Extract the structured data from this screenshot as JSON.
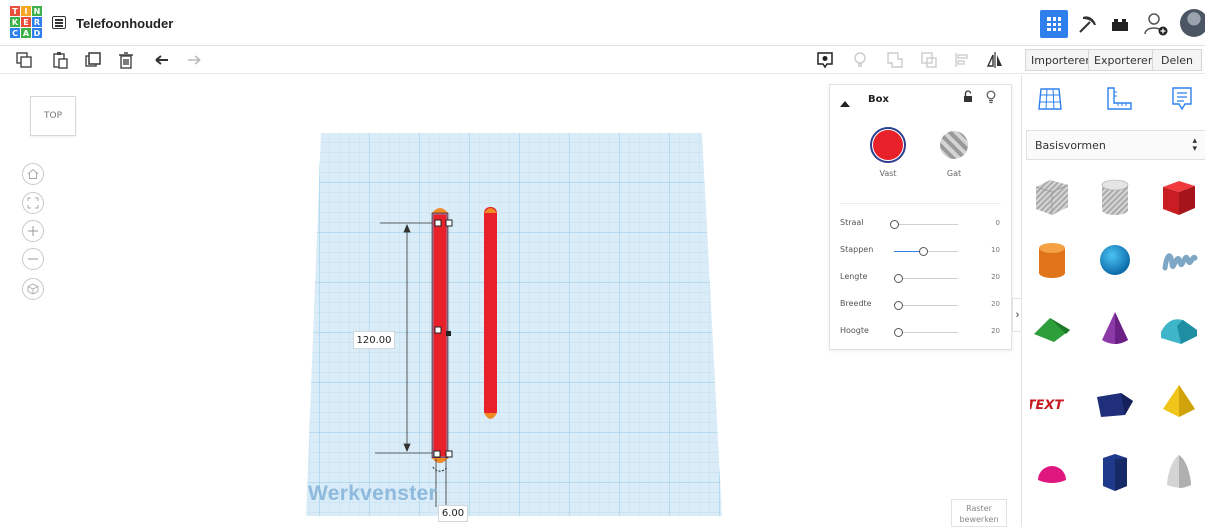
{
  "app": {
    "logo_letters": [
      "T",
      "I",
      "N",
      "K",
      "E",
      "R",
      "C",
      "A",
      "D"
    ],
    "logo_colors": [
      "#e94e3c",
      "#f5a623",
      "#3db049",
      "#3db049",
      "#e94e3c",
      "#2f80ed",
      "#2f80ed",
      "#3db049",
      "#2f80ed"
    ],
    "design_title": "Telefoonhouder"
  },
  "header": {
    "icons": [
      "grid-view-icon",
      "pickaxe-icon",
      "bricks-icon",
      "add-user-icon",
      "avatar"
    ]
  },
  "toolbar": {
    "tools": [
      "copy-icon",
      "paste-icon",
      "duplicate-icon",
      "delete-icon",
      "undo-icon",
      "redo-icon"
    ],
    "view_tools": [
      "show-hide-icon",
      "light-bulb-icon",
      "group-icon",
      "ungroup-icon",
      "align-icon",
      "mirror-icon"
    ],
    "import_label": "Importeren",
    "export_label": "Exporteren",
    "share_label": "Delen"
  },
  "viewport": {
    "view_cube_label": "TOP",
    "nav_buttons": [
      "home-view-icon",
      "fit-view-icon",
      "zoom-in-icon",
      "zoom-out-icon",
      "perspective-icon"
    ],
    "dimension_length": "120.00",
    "dimension_width": "6.00",
    "workplane_label": "Werkvenster",
    "grid_edit_label_line1": "Raster",
    "grid_edit_label_line2": "bewerken"
  },
  "inspector": {
    "title": "Box",
    "solid_label": "Vast",
    "hole_label": "Gat",
    "solid_color": "#e8202a",
    "properties": [
      {
        "name": "Straal",
        "value": "0",
        "fraction": 0.0
      },
      {
        "name": "Stappen",
        "value": "10",
        "fraction": 0.45
      },
      {
        "name": "Lengte",
        "value": "20",
        "fraction": 0.06
      },
      {
        "name": "Breedte",
        "value": "20",
        "fraction": 0.06
      },
      {
        "name": "Hoogte",
        "value": "20",
        "fraction": 0.06
      }
    ]
  },
  "shapes_panel": {
    "tabs": [
      "workplane-grid-icon",
      "ruler-icon",
      "notes-icon"
    ],
    "category": "Basisvormen",
    "shapes": [
      "box-hole",
      "cylinder-hole",
      "box",
      "cylinder",
      "sphere",
      "scribble",
      "roof",
      "cone",
      "round-roof",
      "text",
      "wedge",
      "pyramid",
      "half-sphere",
      "polygon",
      "paraboloid"
    ]
  }
}
